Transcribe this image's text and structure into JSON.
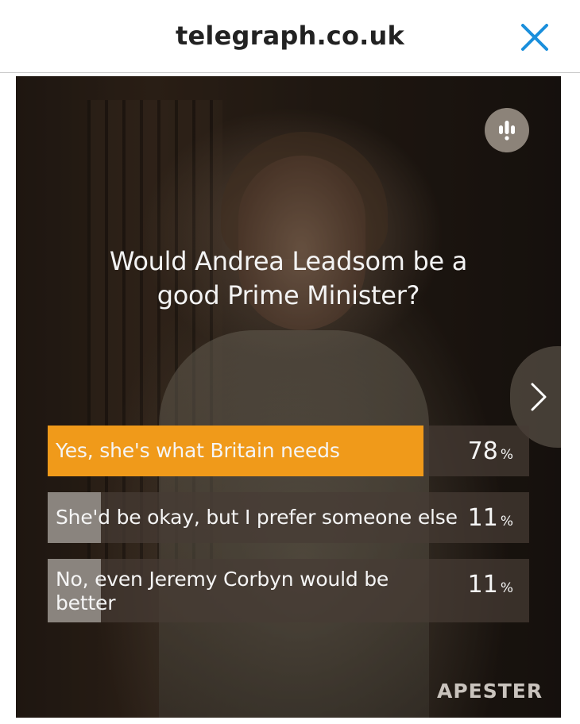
{
  "header": {
    "site": "telegraph.co.uk"
  },
  "poll": {
    "question": "Would Andrea Leadsom be a good Prime Minister?",
    "answers": [
      {
        "label": "Yes, she's what Britain needs",
        "percent": "78",
        "sign": "%",
        "fill_fraction": 0.78,
        "highlighted": true
      },
      {
        "label": "She'd be okay, but I prefer someone else",
        "percent": "11",
        "sign": "%",
        "fill_fraction": 0.11,
        "highlighted": false
      },
      {
        "label": "No, even Jeremy Corbyn would be better",
        "percent": "11",
        "sign": "%",
        "fill_fraction": 0.11,
        "highlighted": false
      }
    ]
  },
  "brand": {
    "logo_text": "APESTER"
  },
  "colors": {
    "accent_orange": "#f09a1a",
    "close_icon_blue": "#1a8fdc",
    "bar_muted": "#8a847e"
  },
  "icons": {
    "close": "close-icon",
    "brand": "apester-icon",
    "next": "chevron-right-icon"
  }
}
